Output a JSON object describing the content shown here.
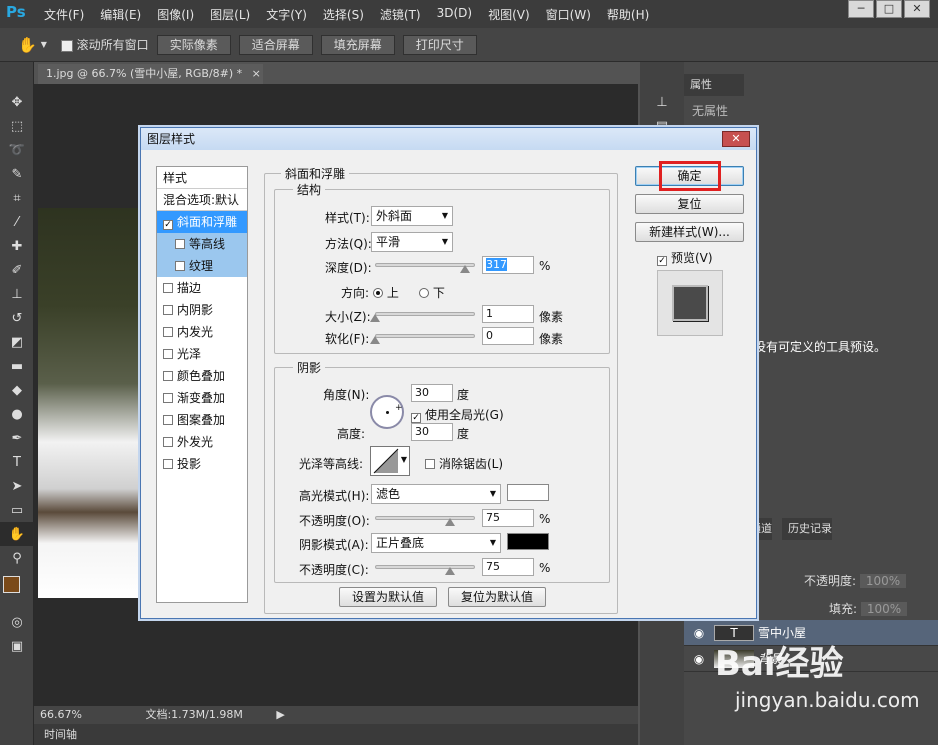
{
  "app": {
    "logo": "Ps"
  },
  "menu": [
    "文件(F)",
    "编辑(E)",
    "图像(I)",
    "图层(L)",
    "文字(Y)",
    "选择(S)",
    "滤镜(T)",
    "3D(D)",
    "视图(V)",
    "窗口(W)",
    "帮助(H)"
  ],
  "options": {
    "scroll_all": "滚动所有窗口",
    "actual_pixels": "实际像素",
    "fit_screen": "适合屏幕",
    "fill_screen": "填充屏幕",
    "print_size": "打印尺寸"
  },
  "document": {
    "tab": "1.jpg @ 66.7% (雪中小屋, RGB/8#) *",
    "zoom": "66.67%",
    "doc_size": "文档:1.73M/1.98M",
    "timeline": "时间轴"
  },
  "panels": {
    "properties_tab": "属性",
    "no_properties": "无属性",
    "presets_text": "没有可定义的工具预设。",
    "channels_tab": "通道",
    "history_tab": "历史记录",
    "opacity_label": "不透明度:",
    "opacity_value": "100%",
    "fill_label": "填充:",
    "fill_value": "100%",
    "layers": [
      {
        "name": "雪中小屋",
        "type": "T"
      },
      {
        "name": "背景",
        "type": "image"
      }
    ]
  },
  "dialog": {
    "title": "图层样式",
    "styles_header": "样式",
    "blend_options": "混合选项:默认",
    "styles": [
      {
        "label": "斜面和浮雕",
        "checked": true,
        "selected": true,
        "sub": false
      },
      {
        "label": "等高线",
        "checked": false,
        "selected": false,
        "sub": true
      },
      {
        "label": "纹理",
        "checked": false,
        "selected": false,
        "sub": true
      },
      {
        "label": "描边",
        "checked": false,
        "sub": false
      },
      {
        "label": "内阴影",
        "checked": false,
        "sub": false
      },
      {
        "label": "内发光",
        "checked": false,
        "sub": false
      },
      {
        "label": "光泽",
        "checked": false,
        "sub": false
      },
      {
        "label": "颜色叠加",
        "checked": false,
        "sub": false
      },
      {
        "label": "渐变叠加",
        "checked": false,
        "sub": false
      },
      {
        "label": "图案叠加",
        "checked": false,
        "sub": false
      },
      {
        "label": "外发光",
        "checked": false,
        "sub": false
      },
      {
        "label": "投影",
        "checked": false,
        "sub": false
      }
    ],
    "section_title": "斜面和浮雕",
    "structure": {
      "title": "结构",
      "style_label": "样式(T):",
      "style_value": "外斜面",
      "technique_label": "方法(Q):",
      "technique_value": "平滑",
      "depth_label": "深度(D):",
      "depth_value": "317",
      "depth_unit": "%",
      "depth_pct": 0.9,
      "direction_label": "方向:",
      "dir_up": "上",
      "dir_down": "下",
      "size_label": "大小(Z):",
      "size_value": "1",
      "size_unit": "像素",
      "size_pct": 0.0,
      "soften_label": "软化(F):",
      "soften_value": "0",
      "soften_unit": "像素",
      "soften_pct": 0.0
    },
    "shading": {
      "title": "阴影",
      "angle_label": "角度(N):",
      "angle_value": "30",
      "angle_unit": "度",
      "global_light": "使用全局光(G)",
      "altitude_label": "高度:",
      "altitude_value": "30",
      "altitude_unit": "度",
      "gloss_label": "光泽等高线:",
      "anti_alias": "消除锯齿(L)",
      "highlight_label": "高光模式(H):",
      "highlight_value": "滤色",
      "highlight_color": "#ffffff",
      "hl_opacity_label": "不透明度(O):",
      "hl_opacity_value": "75",
      "hl_opacity_pct": 0.75,
      "shadow_label": "阴影模式(A):",
      "shadow_value": "正片叠底",
      "shadow_color": "#000000",
      "sh_opacity_label": "不透明度(C):",
      "sh_opacity_value": "75",
      "sh_opacity_pct": 0.75,
      "pct": "%"
    },
    "make_default": "设置为默认值",
    "reset_default": "复位为默认值",
    "ok": "确定",
    "reset": "复位",
    "new_style": "新建样式(W)...",
    "preview": "预览(V)"
  },
  "watermark": {
    "brand": "Bai经验",
    "url": "jingyan.baidu.com"
  }
}
